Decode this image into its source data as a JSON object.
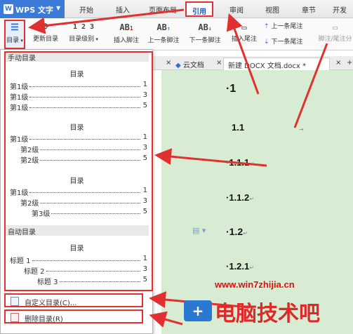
{
  "app": {
    "name": "WPS 文字"
  },
  "menu": [
    "开始",
    "插入",
    "页面布局",
    "引用",
    "审阅",
    "视图",
    "章节",
    "开发"
  ],
  "ribbon": {
    "toc_button": "目录",
    "toc_update": "更新目录",
    "toc_level": "目录级别",
    "insert_footnote": "插入脚注",
    "prev_footnote": "上一条脚注",
    "next_footnote": "下一条脚注",
    "insert_endnote": "插入尾注",
    "prev_endnote": "上一条尾注",
    "next_endnote": "下一条尾注",
    "footnote_endnote": "脚注/尾注分"
  },
  "tabs": {
    "cloud": "云文档",
    "doc": "新建 DOCX 文档.docx *"
  },
  "dropdown": {
    "manual_header": "手动目录",
    "auto_header": "自动目录",
    "toc_title": "目录",
    "block1": [
      {
        "label": "第1级",
        "page": "1"
      },
      {
        "label": "第1级",
        "page": "3"
      },
      {
        "label": "第1级",
        "page": "5"
      }
    ],
    "block2": [
      {
        "label": "第1级",
        "page": "1"
      },
      {
        "label": "第2级",
        "page": "3"
      },
      {
        "label": "第2级",
        "page": "5"
      }
    ],
    "block3": [
      {
        "label": "第1级",
        "page": "1"
      },
      {
        "label": "第2级",
        "page": "3"
      },
      {
        "label": "第3级",
        "page": "5"
      }
    ],
    "block4": [
      {
        "label": "标题 1",
        "page": "1"
      },
      {
        "label": "标题 2",
        "page": "3"
      },
      {
        "label": "标题 3",
        "page": "5"
      }
    ],
    "custom_toc": "自定义目录(C)...",
    "delete_toc": "删除目录(R)"
  },
  "document": {
    "headings": [
      "1",
      "1.1",
      "1.1.1",
      "1.1.2",
      "1.2",
      "1.2.1"
    ]
  },
  "watermark": {
    "url": "www.win7zhijia.cn",
    "site": "电脑技术吧"
  }
}
